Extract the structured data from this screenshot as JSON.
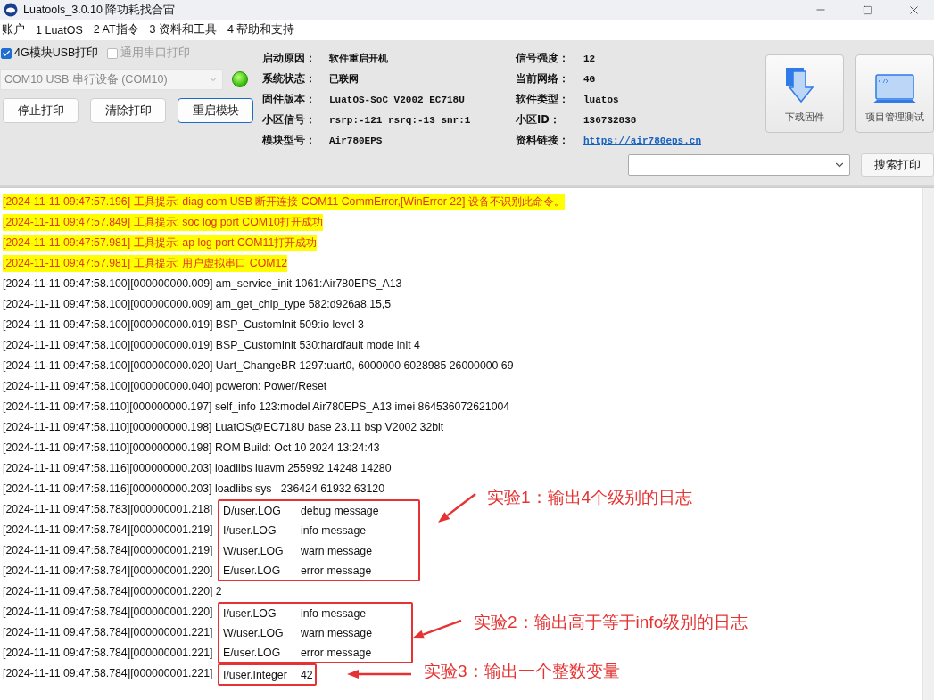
{
  "window": {
    "title": "Luatools_3.0.10 降功耗找合宙"
  },
  "menu": [
    "账户",
    "1 LuatOS",
    "2 AT指令",
    "3 资料和工具",
    "4 帮助和支持"
  ],
  "print_options": [
    {
      "label": "4G模块USB打印",
      "checked": true,
      "disabled": false
    },
    {
      "label": "通用串口打印",
      "checked": false,
      "disabled": true
    }
  ],
  "port": {
    "value": "COM10 USB 串行设备 (COM10)",
    "disabled": true,
    "connected": true
  },
  "buttons": [
    {
      "label": "停止打印",
      "focused": false
    },
    {
      "label": "清除打印",
      "focused": false
    },
    {
      "label": "重启模块",
      "focused": true
    }
  ],
  "info_left": [
    {
      "label": "启动原因：",
      "value": "软件重启开机",
      "kind": "text"
    },
    {
      "label": "系统状态：",
      "value": "已联网",
      "kind": "text"
    },
    {
      "label": "固件版本：",
      "value": "LuatOS-SoC_V2002_EC718U",
      "kind": "text"
    },
    {
      "label": "小区信号：",
      "value": "rsrp:-121 rsrq:-13 snr:1",
      "kind": "text"
    },
    {
      "label": "模块型号：",
      "value": "Air780EPS",
      "kind": "text"
    }
  ],
  "info_right": [
    {
      "label": "信号强度：",
      "value": "12",
      "kind": "text"
    },
    {
      "label": "当前网络：",
      "value": "4G",
      "kind": "text"
    },
    {
      "label": "软件类型：",
      "value": "luatos",
      "kind": "text"
    },
    {
      "label": "小区ID：",
      "value": "136732838",
      "kind": "text"
    },
    {
      "label": "资料链接：",
      "value": "https://air780eps.cn",
      "kind": "link"
    }
  ],
  "tools": [
    {
      "label": "下载固件",
      "kind": "download"
    },
    {
      "label": "项目管理测试",
      "kind": "laptop"
    }
  ],
  "search": {
    "button": "搜索打印"
  },
  "log": [
    {
      "kind": "plain",
      "lines": [
        {
          "stamp": "[2024-11-11 09:47:57.196] 工具提示: diag com USB 断开连接 COM11 CommError,[WinError 22] 设备不识别此命令。",
          "kind": "tool"
        },
        {
          "stamp": "[2024-11-11 09:47:57.849] 工具提示: soc log port COM10打开成功",
          "kind": "tool"
        },
        {
          "stamp": "[2024-11-11 09:47:57.981] 工具提示: ap log port COM11打开成功",
          "kind": "tool"
        },
        {
          "stamp": "[2024-11-11 09:47:57.981] 工具提示: 用户虚拟串口 COM12",
          "kind": "tool"
        },
        {
          "stamp": "[2024-11-11 09:47:58.100][000000000.009] am_service_init 1061:Air780EPS_A13",
          "kind": "normal"
        },
        {
          "stamp": "[2024-11-11 09:47:58.100][000000000.009] am_get_chip_type 582:d926a8,15,5",
          "kind": "normal"
        },
        {
          "stamp": "[2024-11-11 09:47:58.100][000000000.019] BSP_CustomInit 509:io level 3",
          "kind": "normal"
        },
        {
          "stamp": "[2024-11-11 09:47:58.100][000000000.019] BSP_CustomInit 530:hardfault mode init 4",
          "kind": "normal"
        },
        {
          "stamp": "[2024-11-11 09:47:58.100][000000000.020] Uart_ChangeBR 1297:uart0, 6000000 6028985 26000000 69",
          "kind": "normal"
        },
        {
          "stamp": "[2024-11-11 09:47:58.100][000000000.040] poweron: Power/Reset",
          "kind": "normal"
        },
        {
          "stamp": "[2024-11-11 09:47:58.110][000000000.197] self_info 123:model Air780EPS_A13 imei 864536072621004",
          "kind": "normal"
        },
        {
          "stamp": "[2024-11-11 09:47:58.110][000000000.198] LuatOS@EC718U base 23.11 bsp V2002 32bit",
          "kind": "normal"
        },
        {
          "stamp": "[2024-11-11 09:47:58.110][000000000.198] ROM Build: Oct 10 2024 13:24:43",
          "kind": "normal"
        },
        {
          "stamp": "[2024-11-11 09:47:58.116][000000000.203] loadlibs luavm 255992 14248 14280",
          "kind": "normal"
        },
        {
          "stamp": "[2024-11-11 09:47:58.116][000000000.203] loadlibs sys   236424 61932 63120",
          "kind": "normal"
        }
      ]
    },
    {
      "kind": "annotated",
      "note": "实验1：输出4个级别的日志",
      "lines": [
        {
          "stamp": "[2024-11-11 09:47:58.783][000000001.218]",
          "tag": "D/user.LOG",
          "message": "debug message"
        },
        {
          "stamp": "[2024-11-11 09:47:58.784][000000001.219]",
          "tag": "I/user.LOG",
          "message": "info message"
        },
        {
          "stamp": "[2024-11-11 09:47:58.784][000000001.219]",
          "tag": "W/user.LOG",
          "message": "warn message"
        },
        {
          "stamp": "[2024-11-11 09:47:58.784][000000001.220]",
          "tag": "E/user.LOG",
          "message": "error message"
        }
      ]
    },
    {
      "kind": "plain",
      "lines": [
        {
          "stamp": "[2024-11-11 09:47:58.784][000000001.220] 2",
          "kind": "normal"
        }
      ]
    },
    {
      "kind": "annotated",
      "note": "实验2：输出高于等于info级别的日志",
      "lines": [
        {
          "stamp": "[2024-11-11 09:47:58.784][000000001.220]",
          "tag": "I/user.LOG",
          "message": "info message"
        },
        {
          "stamp": "[2024-11-11 09:47:58.784][000000001.221]",
          "tag": "W/user.LOG",
          "message": "warn message"
        },
        {
          "stamp": "[2024-11-11 09:47:58.784][000000001.221]",
          "tag": "E/user.LOG",
          "message": "error message"
        }
      ]
    },
    {
      "kind": "annotated",
      "note": "实验3：输出一个整数变量",
      "lines": [
        {
          "stamp": "[2024-11-11 09:47:58.784][000000001.221]",
          "tag": "I/user.Integer",
          "message": "42"
        }
      ]
    }
  ]
}
